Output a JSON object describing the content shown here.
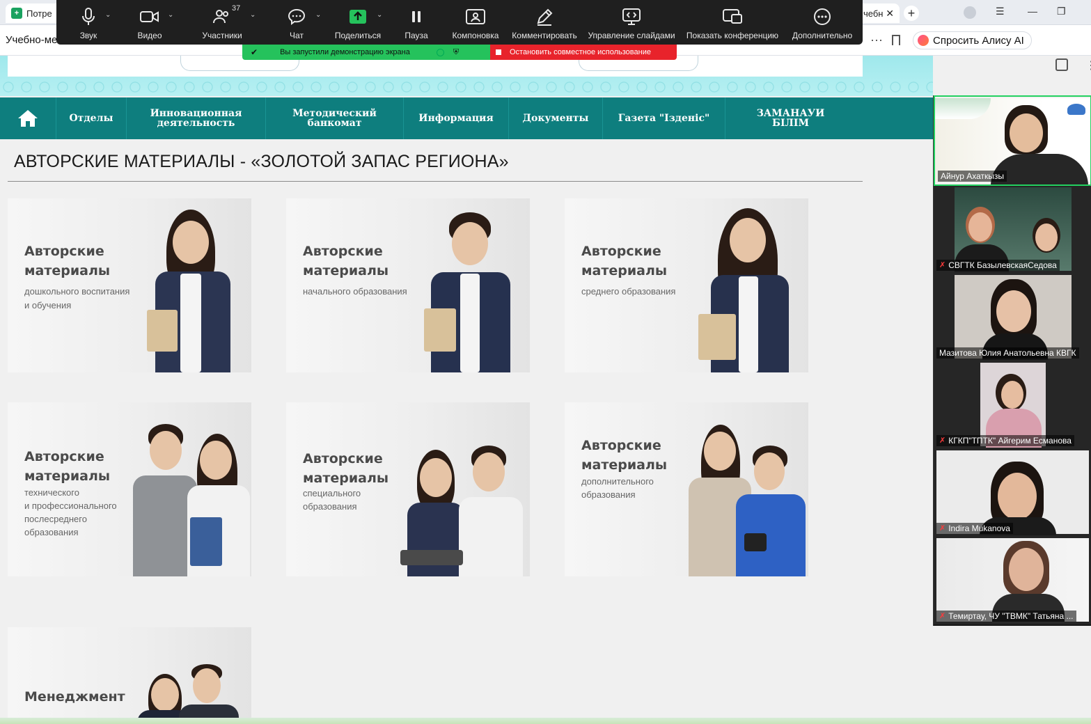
{
  "browser": {
    "tab_left_label": "Потре",
    "tab_right_label": "чебн",
    "page_title_short": "Учебно-ме",
    "alice_label": "Спросить Алису AI"
  },
  "zoom_toolbar": {
    "items": [
      {
        "label": "Звук",
        "icon": "microphone-icon"
      },
      {
        "label": "Видео",
        "icon": "video-camera-icon"
      },
      {
        "label": "Участники",
        "icon": "participants-icon",
        "count": "37"
      },
      {
        "label": "Чат",
        "icon": "chat-icon"
      },
      {
        "label": "Поделиться",
        "icon": "share-screen-icon"
      },
      {
        "label": "Пауза",
        "icon": "pause-icon"
      },
      {
        "label": "Компоновка",
        "icon": "layout-icon"
      },
      {
        "label": "Комментировать",
        "icon": "annotate-pen-icon"
      },
      {
        "label": "Управление слайдами",
        "icon": "slide-control-icon"
      },
      {
        "label": "Показать конференцию",
        "icon": "show-meeting-icon"
      },
      {
        "label": "Дополнительно",
        "icon": "more-icon"
      }
    ],
    "share_active_text": "Вы запустили демонстрацию экрана",
    "stop_share_text": "Остановить совместное использование",
    "colors": {
      "share_green": "#25c25c",
      "stop_red": "#e8232b",
      "bar_bg": "#1f1f1f"
    }
  },
  "nav": {
    "items": [
      {
        "label": "Отделы"
      },
      {
        "label": "Инновационная деятельность"
      },
      {
        "label": "Методический банкомат"
      },
      {
        "label": "Информация"
      },
      {
        "label": "Документы"
      },
      {
        "label": "Газета \"Ізденіс\""
      },
      {
        "label": "ЗАМАНАУИ БІЛІМ"
      }
    ],
    "color": "#0e7e7e"
  },
  "main": {
    "title": "АВТОРСКИЕ МАТЕРИАЛЫ - «ЗОЛОТОЙ ЗАПАС РЕГИОНА»",
    "cards": [
      {
        "heading_1": "Авторские",
        "heading_2": "материалы",
        "sub_lines": [
          "дошкольного воспитания",
          "и обучения"
        ]
      },
      {
        "heading_1": "Авторские",
        "heading_2": "материалы",
        "sub_lines": [
          "начального образования"
        ]
      },
      {
        "heading_1": "Авторские",
        "heading_2": "материалы",
        "sub_lines": [
          "среднего образования"
        ]
      },
      {
        "heading_1": "Авторские",
        "heading_2": "материалы",
        "sub_lines": [
          "технического",
          "и профессионального",
          "послесреднего",
          "образования"
        ]
      },
      {
        "heading_1": "Авторские",
        "heading_2": "материалы",
        "sub_lines": [
          "специального",
          "образования"
        ]
      },
      {
        "heading_1": "Авторские",
        "heading_2": "материалы",
        "sub_lines": [
          "дополнительного",
          "образования"
        ]
      },
      {
        "heading_1": "Менеджмент",
        "heading_2": "",
        "sub_lines": []
      }
    ]
  },
  "participants": [
    {
      "name": "Айнур Ахаткызы",
      "muted": false,
      "active": true
    },
    {
      "name": "СВГТК БазылевскаяСедова",
      "muted": true,
      "active": false
    },
    {
      "name": "Мазитова Юлия Анатольевна КВГК",
      "muted": false,
      "active": false
    },
    {
      "name": "КГКП\"ТПТК\" Айгерим Есманова",
      "muted": true,
      "active": false
    },
    {
      "name": "Indira Mukanova",
      "muted": true,
      "active": false
    },
    {
      "name": "Темиртау, ЧУ \"ТВМК\" Татьяна ...",
      "muted": true,
      "active": false
    }
  ]
}
